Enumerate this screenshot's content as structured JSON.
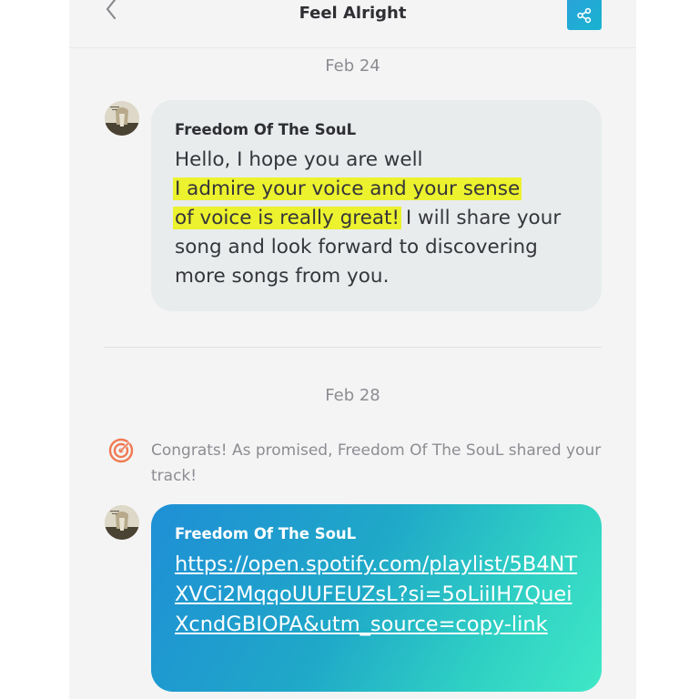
{
  "header": {
    "title": "Feel Alright",
    "back_icon": "chevron-left-icon",
    "share_icon": "share-icon",
    "share_color": "#1faad6"
  },
  "messages": [
    {
      "date": "Feb 24",
      "sender": "Freedom Of The SouL",
      "text_lines": {
        "plain_start": "Hello, I hope you are well",
        "highlight_1": "I admire your voice and your sense",
        "highlight_2": "of voice is really great!",
        "plain_end": " I will share your song and look forward to discovering more songs from you."
      }
    },
    {
      "date": "Feb 28",
      "notice": "Congrats! As promised, Freedom Of The SouL shared your track!",
      "notice_icon": "target-icon",
      "sender": "Freedom Of The SouL",
      "link": "https://open.spotify.com/playlist/5B4NTXVCi2MqqoUUFEUZsL?si=5oLiiIH7QueiXcndGBIOPA&utm_source=copy-link"
    }
  ],
  "colors": {
    "highlight": "#ecf22e",
    "notice_icon": "#f07a52",
    "bubble_grey": "#e8eced"
  }
}
